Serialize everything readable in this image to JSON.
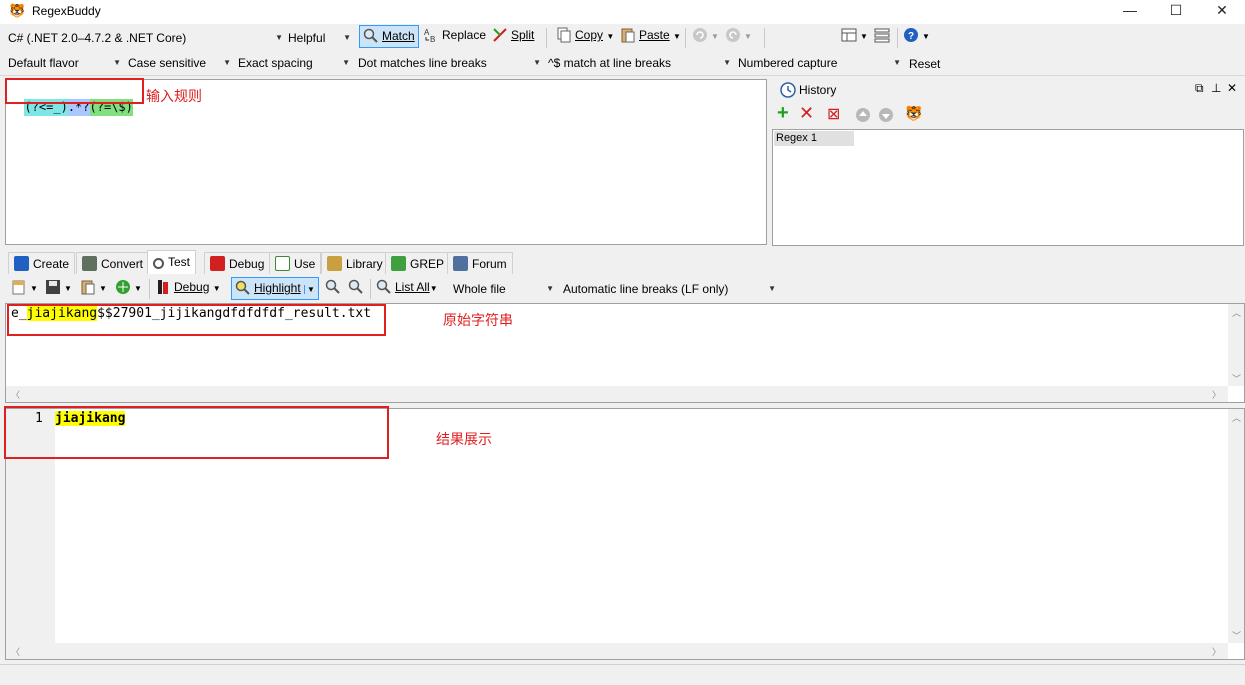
{
  "window": {
    "title": "RegexBuddy",
    "minimize": "—",
    "maximize": "☐",
    "close": "✕"
  },
  "toolbar1": {
    "flavor": "C# (.NET 2.0–4.7.2 & .NET Core)",
    "helpful": "Helpful",
    "match": "Match",
    "replace": "Replace",
    "split": "Split",
    "copy": "Copy",
    "paste": "Paste"
  },
  "toolbar2": {
    "default_flavor": "Default flavor",
    "case": "Case sensitive",
    "spacing": "Exact spacing",
    "dot": "Dot matches line breaks",
    "caret": "^$ match at line breaks",
    "capture": "Numbered capture",
    "reset": "Reset"
  },
  "regex": {
    "segments": [
      "(?<=_)",
      ".*?",
      "(?=\\$)"
    ],
    "colors": {
      "lookbehind": "#7fe6e6",
      "lazy": "#a8c8ff",
      "lookahead": "#80e080"
    },
    "annotation": "输入规则"
  },
  "history": {
    "title": "History",
    "items": [
      "Regex 1"
    ]
  },
  "tabs": [
    "Create",
    "Convert",
    "Test",
    "Debug",
    "Use",
    "Library",
    "GREP",
    "Forum"
  ],
  "test_toolbar": {
    "debug": "Debug",
    "highlight": "Highlight",
    "list_all": "List All",
    "scope": "Whole file",
    "line_breaks": "Automatic line breaks (LF only)"
  },
  "subject": {
    "prefix": "e_",
    "match": "jiajikang",
    "suffix": "$$27901_jijikangdfdfdfdf_result.txt",
    "annotation": "原始字符串"
  },
  "results": {
    "line_number": "1",
    "value": "jiajikang",
    "annotation": "结果展示"
  }
}
